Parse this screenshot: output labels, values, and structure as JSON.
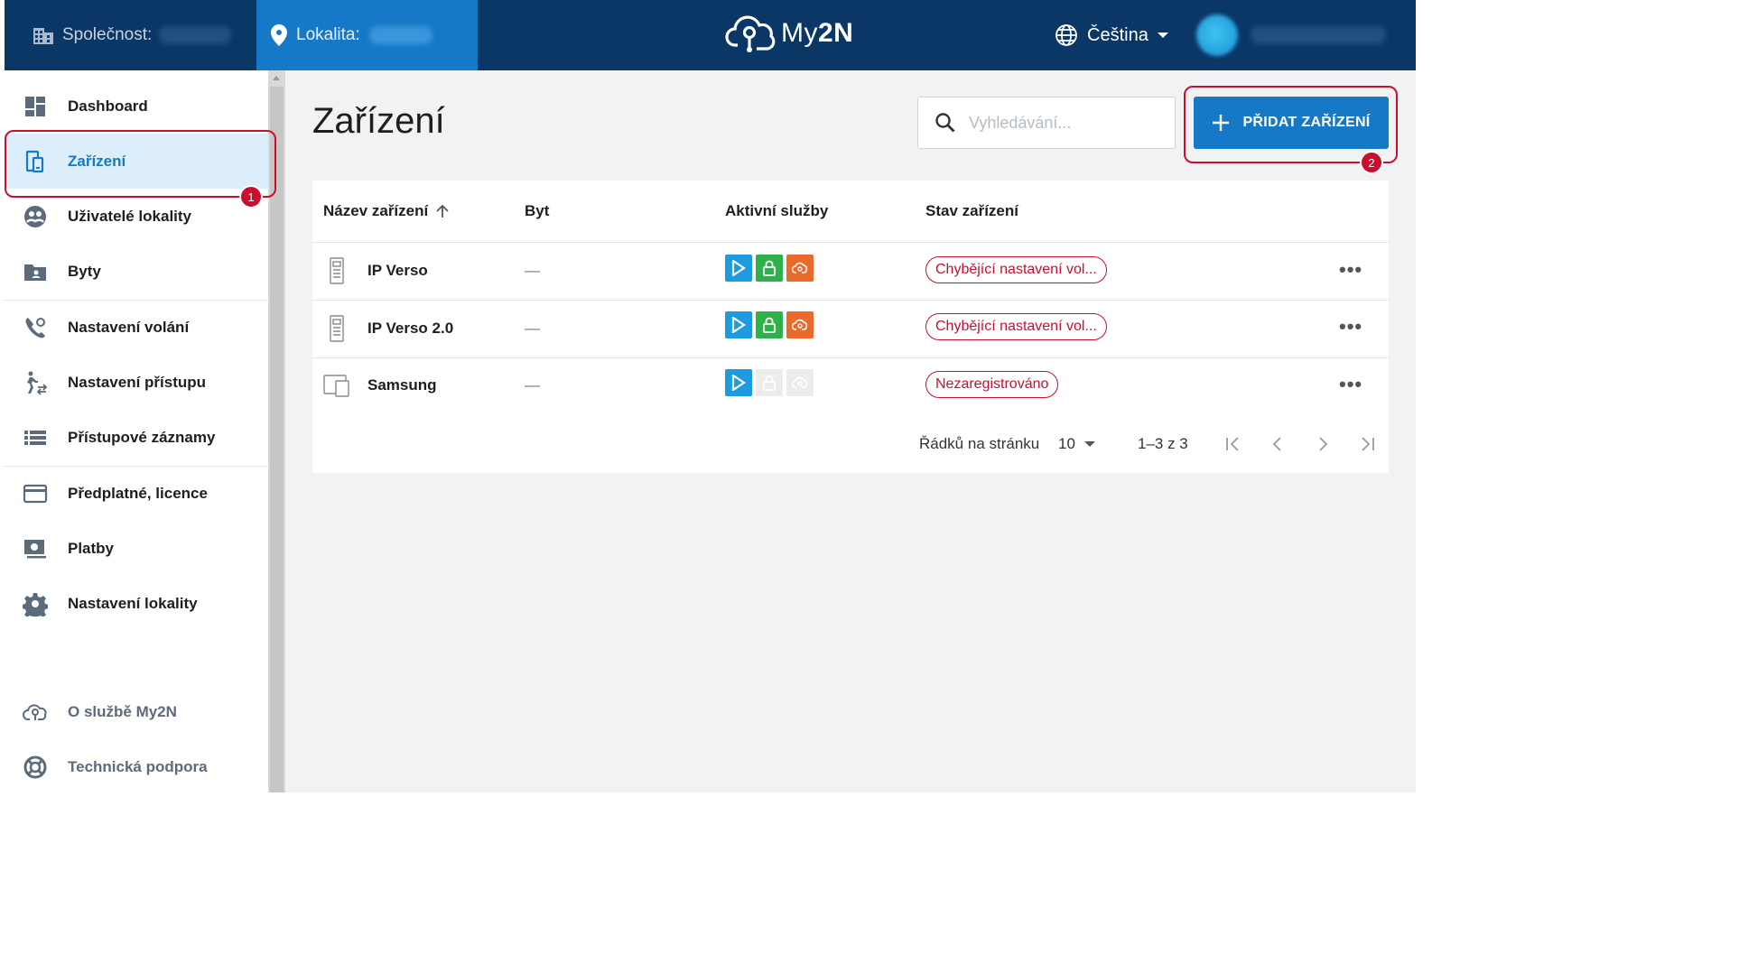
{
  "header": {
    "company_label": "Společnost:",
    "location_label": "Lokalita:",
    "logo_text_light": "My",
    "logo_text_bold": "2N",
    "language": "Čeština"
  },
  "sidebar": {
    "items": [
      {
        "label": "Dashboard",
        "icon": "dashboard-icon"
      },
      {
        "label": "Zařízení",
        "icon": "device-icon",
        "active": true
      },
      {
        "label": "Uživatelé lokality",
        "icon": "users-icon"
      },
      {
        "label": "Byty",
        "icon": "folder-icon"
      },
      {
        "label": "Nastavení volání",
        "icon": "phone-settings-icon"
      },
      {
        "label": "Nastavení přístupu",
        "icon": "access-icon"
      },
      {
        "label": "Přístupové záznamy",
        "icon": "list-icon"
      },
      {
        "label": "Předplatné, licence",
        "icon": "card-icon"
      },
      {
        "label": "Platby",
        "icon": "payment-icon"
      },
      {
        "label": "Nastavení lokality",
        "icon": "gear-icon"
      }
    ],
    "footer": [
      {
        "label": "O službě My2N",
        "icon": "cloud-icon"
      },
      {
        "label": "Technická podpora",
        "icon": "support-icon"
      }
    ]
  },
  "main": {
    "title": "Zařízení",
    "search_placeholder": "Vyhledávání...",
    "add_button": "PŘIDAT ZAŘÍZENÍ",
    "columns": [
      "Název zařízení",
      "Byt",
      "Aktivní služby",
      "Stav zařízení"
    ],
    "rows": [
      {
        "name": "IP Verso",
        "apartment": "—",
        "services": [
          "active",
          "active",
          "active"
        ],
        "status": "Chybějící nastavení vol..."
      },
      {
        "name": "IP Verso 2.0",
        "apartment": "—",
        "services": [
          "active",
          "active",
          "active"
        ],
        "status": "Chybějící nastavení vol..."
      },
      {
        "name": "Samsung",
        "apartment": "—",
        "services": [
          "active",
          "inactive",
          "inactive"
        ],
        "status": "Nezaregistrováno"
      }
    ],
    "pagination": {
      "rows_per_page_label": "Řádků na stránku",
      "rows_per_page": "10",
      "range": "1–3 z 3"
    }
  },
  "annotations": [
    "1",
    "2"
  ],
  "colors": {
    "topbar": "#0b3766",
    "accent": "#1679c7",
    "danger": "#c8102e",
    "svc_blue": "#1e9be0",
    "svc_green": "#2fb04a",
    "svc_orange": "#ea6a2c"
  }
}
